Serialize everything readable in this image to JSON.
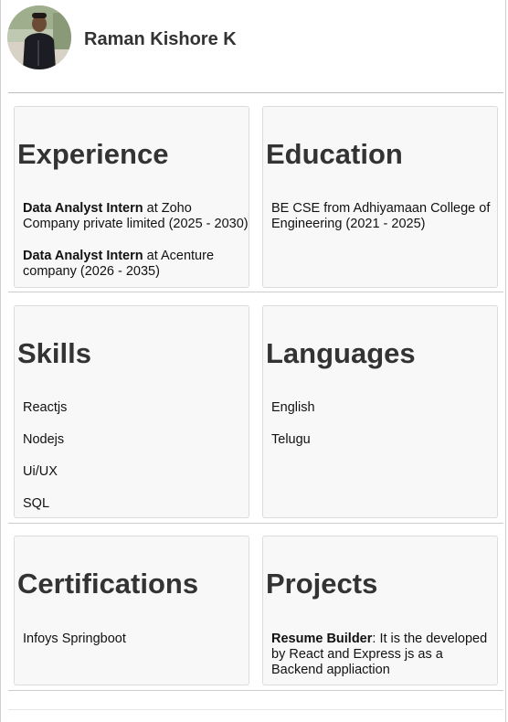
{
  "profile": {
    "name": "Raman Kishore K"
  },
  "experience": {
    "title": "Experience",
    "entries": [
      {
        "role": "Data Analyst Intern",
        "connector": " at ",
        "org": "Zoho Company private limited (2025 - 2030)"
      },
      {
        "role": "Data Analyst Intern",
        "connector": " at ",
        "org": "Acenture company (2026 - 2035)"
      }
    ]
  },
  "education": {
    "title": "Education",
    "entries": [
      {
        "text": "BE CSE from Adhiyamaan College of Engineering (2021 - 2025)"
      }
    ]
  },
  "skills": {
    "title": "Skills",
    "items": [
      "Reactjs",
      "Nodejs",
      "Ui/UX",
      "SQL"
    ]
  },
  "languages": {
    "title": "Languages",
    "items": [
      "English",
      "Telugu"
    ]
  },
  "certifications": {
    "title": "Certifications",
    "items": [
      "Infoys Springboot"
    ]
  },
  "projects": {
    "title": "Projects",
    "entries": [
      {
        "name": "Resume Builder",
        "separator": ": ",
        "description": "It is the developed by React and Express js as a Backend appliaction"
      }
    ]
  },
  "colors": {
    "heading": "#333333",
    "card_background": "#f8f8f8",
    "card_border": "#dcdcdc"
  }
}
